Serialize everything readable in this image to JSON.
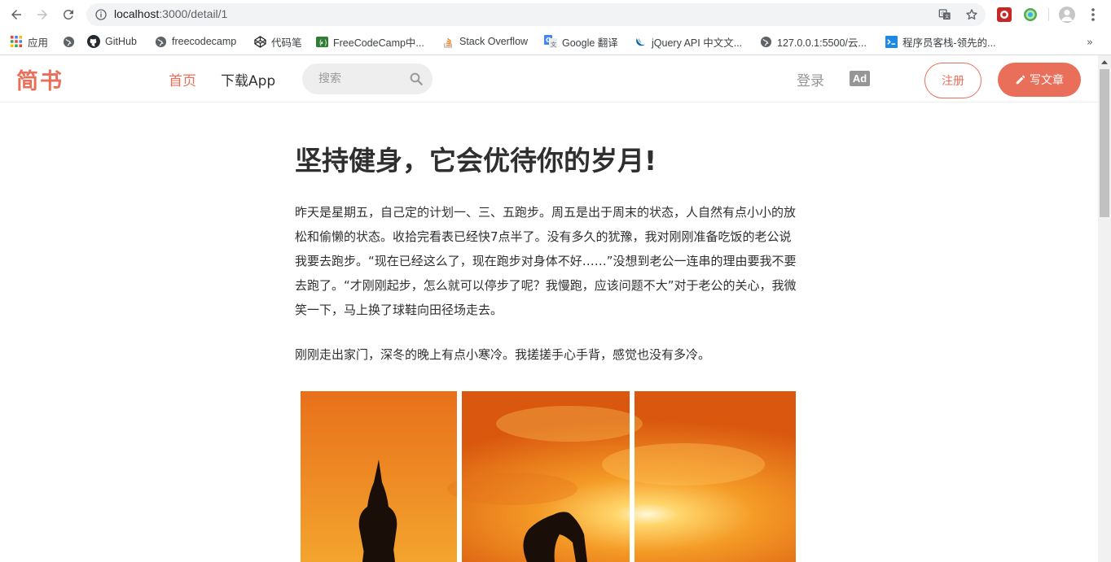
{
  "browser": {
    "url_host": "localhost",
    "url_path": ":3000/detail/1",
    "bookmarks": [
      {
        "label": "应用",
        "icon": "apps-grid-icon"
      },
      {
        "label": "",
        "icon": "globe-icon"
      },
      {
        "label": "GitHub",
        "icon": "github-icon"
      },
      {
        "label": "freecodecamp",
        "icon": "globe-icon"
      },
      {
        "label": "代码笔",
        "icon": "codepen-icon"
      },
      {
        "label": "FreeCodeCamp中...",
        "icon": "freecodecamp-icon"
      },
      {
        "label": "Stack Overflow",
        "icon": "stackoverflow-icon"
      },
      {
        "label": "Google 翻译",
        "icon": "google-translate-icon"
      },
      {
        "label": "jQuery API 中文文...",
        "icon": "jquery-icon"
      },
      {
        "label": "127.0.0.1:5500/云...",
        "icon": "globe-icon"
      },
      {
        "label": "程序员客栈-领先的...",
        "icon": "proginn-icon"
      }
    ],
    "more_bookmarks": "»"
  },
  "header": {
    "logo": "简书",
    "nav_home": "首页",
    "nav_app": "下载App",
    "search_placeholder": "搜索",
    "login": "登录",
    "aa": "Ad",
    "register": "注册",
    "write": "写文章"
  },
  "article": {
    "title": "坚持健身，它会优待你的岁月!",
    "paragraphs": [
      "昨天是星期五，自己定的计划一、三、五跑步。周五是出于周末的状态，人自然有点小小的放松和偷懒的状态。收拾完看表已经快7点半了。没有多久的犹豫，我对刚刚准备吃饭的老公说我要去跑步。“现在已经这么了，现在跑步对身体不好……”没想到老公一连串的理由要我不要去跑了。“才刚刚起步，怎么就可以停步了呢？我慢跑，应该问题不大”对于老公的关心，我微笑一下，马上换了球鞋向田径场走去。",
      "刚刚走出家门，深冬的晚上有点小寒冷。我搓搓手心手背，感觉也没有多冷。"
    ],
    "image_icon": "yoga-sunset-triptych-image"
  },
  "colors": {
    "brand": "#ea6f5a",
    "text": "#2f2f2f",
    "muted": "#969696"
  }
}
